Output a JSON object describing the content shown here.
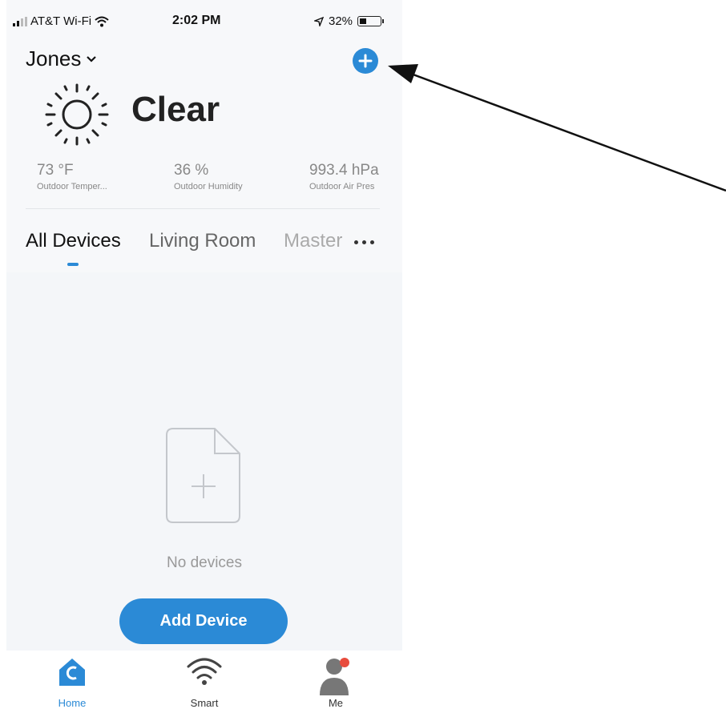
{
  "status_bar": {
    "carrier": "AT&T Wi-Fi",
    "time": "2:02 PM",
    "battery": "32%"
  },
  "header": {
    "home_name": "Jones",
    "add_icon": "plus-circle-icon"
  },
  "weather": {
    "condition": "Clear",
    "icon": "sun-icon",
    "metrics": [
      {
        "value": "73 °F",
        "label": "Outdoor Temper..."
      },
      {
        "value": "36 %",
        "label": "Outdoor Humidity"
      },
      {
        "value": "993.4 hPa",
        "label": "Outdoor Air Pres"
      }
    ]
  },
  "tabs": [
    {
      "label": "All Devices",
      "active": true
    },
    {
      "label": "Living Room",
      "active": false
    },
    {
      "label": "Master",
      "active": false
    }
  ],
  "empty_state": {
    "text": "No devices",
    "button_label": "Add Device"
  },
  "bottom_nav": [
    {
      "label": "Home",
      "icon": "home-icon",
      "active": true
    },
    {
      "label": "Smart",
      "icon": "wifi-icon",
      "active": false
    },
    {
      "label": "Me",
      "icon": "user-icon",
      "active": false
    }
  ],
  "colors": {
    "accent": "#2b8ad6",
    "background": "#f4f6f9",
    "badge": "#e84c3d"
  }
}
